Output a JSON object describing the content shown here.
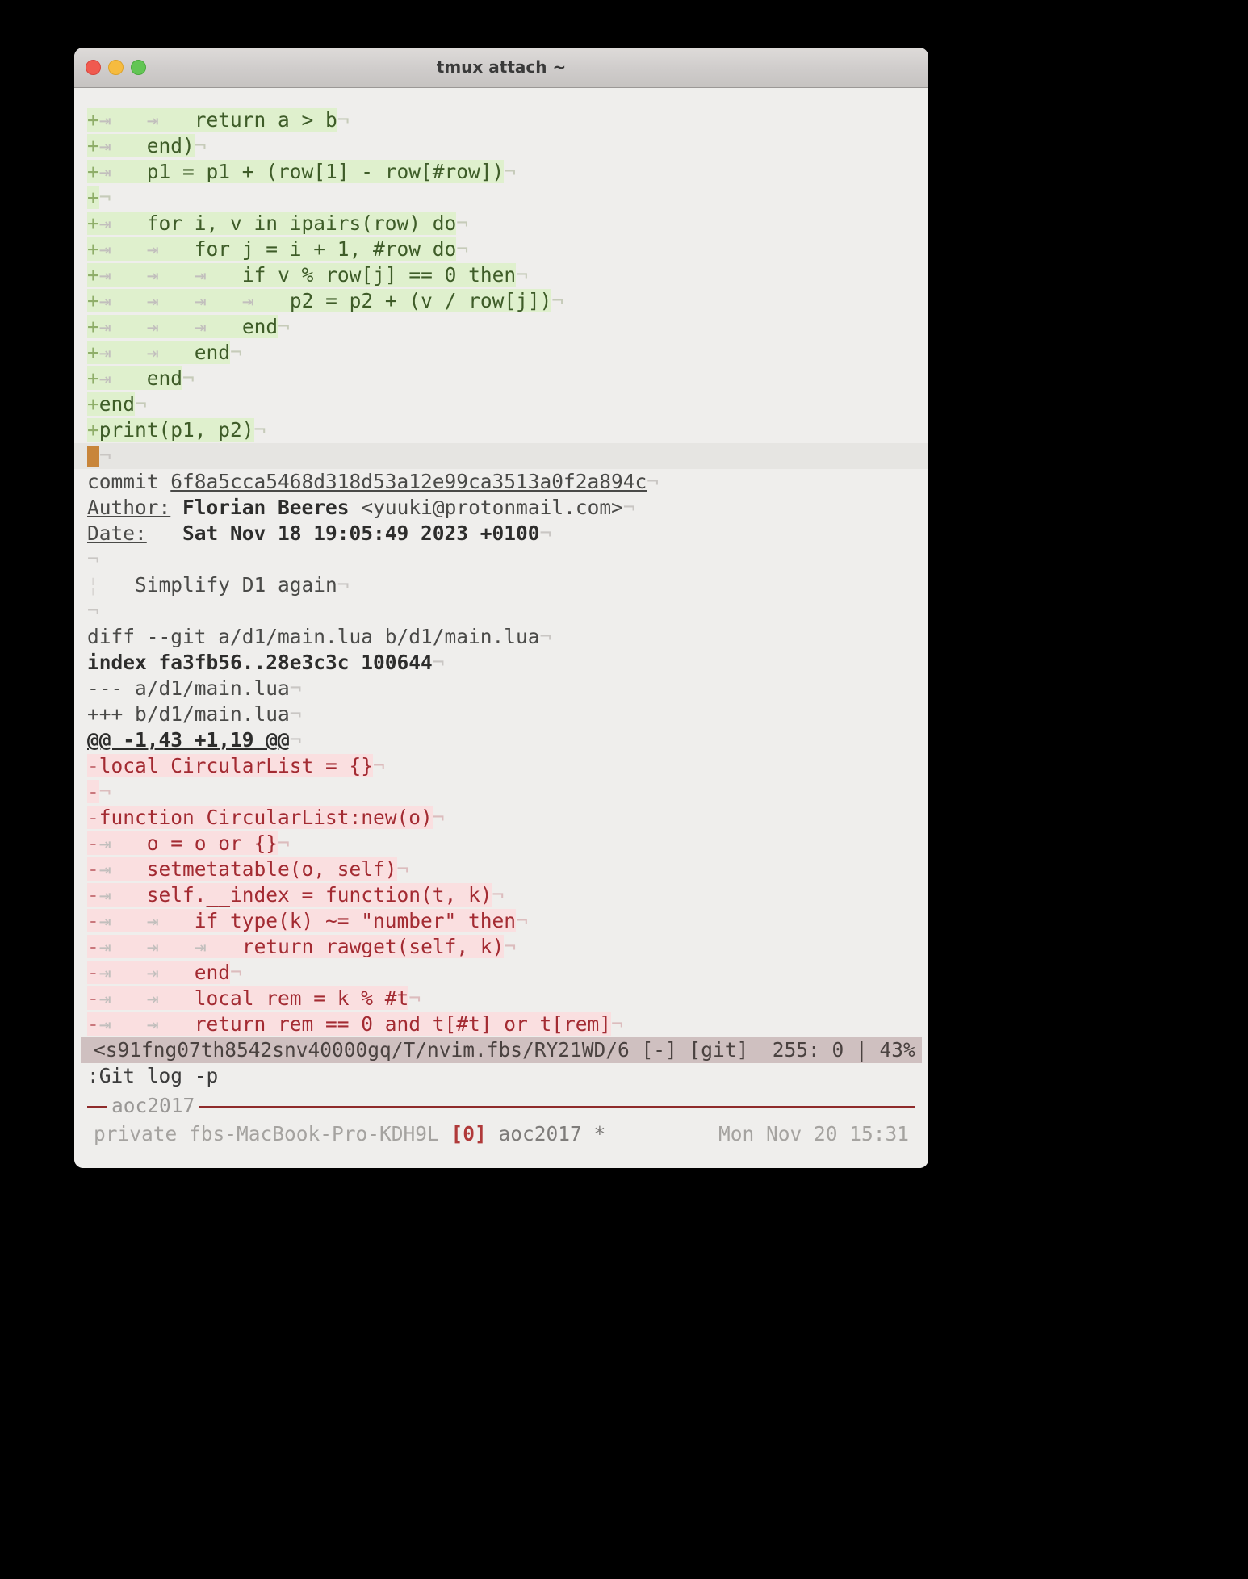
{
  "window": {
    "title": "tmux attach ~",
    "traffic_lights": [
      "close-button",
      "minimize-button",
      "zoom-button"
    ]
  },
  "glyphs": {
    "tab": "⇥",
    "eol": "¬",
    "indent_guide": "¦"
  },
  "terminal": {
    "diff_added": [
      {
        "sign": "+",
        "tabs": 2,
        "text": "return a > b"
      },
      {
        "sign": "+",
        "tabs": 1,
        "text": "end)"
      },
      {
        "sign": "+",
        "tabs": 1,
        "text": "p1 = p1 + (row[1] - row[#row])"
      },
      {
        "sign": "+",
        "tabs": 0,
        "text": ""
      },
      {
        "sign": "+",
        "tabs": 1,
        "text": "for i, v in ipairs(row) do"
      },
      {
        "sign": "+",
        "tabs": 2,
        "text": "for j = i + 1, #row do"
      },
      {
        "sign": "+",
        "tabs": 3,
        "text": "if v % row[j] == 0 then"
      },
      {
        "sign": "+",
        "tabs": 4,
        "text": "p2 = p2 + (v / row[j])"
      },
      {
        "sign": "+",
        "tabs": 3,
        "text": "end"
      },
      {
        "sign": "+",
        "tabs": 2,
        "text": "end"
      },
      {
        "sign": "+",
        "tabs": 1,
        "text": "end"
      },
      {
        "sign": "+",
        "tabs": 0,
        "text": "end"
      },
      {
        "sign": "+",
        "tabs": 0,
        "text": "print(p1, p2)"
      }
    ],
    "commit": {
      "label_commit": "commit ",
      "hash": "6f8a5cca5468d318d53a12e99ca3513a0f2a894c",
      "label_author": "Author:",
      "author_name": "Florian Beeres",
      "author_email": "<yuuki@protonmail.com>",
      "label_date": "Date:",
      "date_value": "Sat Nov 18 19:05:49 2023 +0100",
      "message": "Simplify D1 again"
    },
    "diff_header": {
      "diff_line": "diff --git a/d1/main.lua b/d1/main.lua",
      "index_line": "index fa3fb56..28e3c3c 100644",
      "minus_file": "--- a/d1/main.lua",
      "plus_file": "+++ b/d1/main.lua",
      "hunk": "@@ -1,43 +1,19 @@"
    },
    "diff_removed": [
      {
        "sign": "-",
        "tabs": 0,
        "text": "local CircularList = {}"
      },
      {
        "sign": "-",
        "tabs": 0,
        "text": ""
      },
      {
        "sign": "-",
        "tabs": 0,
        "text": "function CircularList:new(o)"
      },
      {
        "sign": "-",
        "tabs": 1,
        "text": "o = o or {}"
      },
      {
        "sign": "-",
        "tabs": 1,
        "text": "setmetatable(o, self)"
      },
      {
        "sign": "-",
        "tabs": 1,
        "text": "self.__index = function(t, k)"
      },
      {
        "sign": "-",
        "tabs": 2,
        "text": "if type(k) ~= \"number\" then"
      },
      {
        "sign": "-",
        "tabs": 3,
        "text": "return rawget(self, k)"
      },
      {
        "sign": "-",
        "tabs": 2,
        "text": "end"
      },
      {
        "sign": "-",
        "tabs": 2,
        "text": "local rem = k % #t"
      },
      {
        "sign": "-",
        "tabs": 2,
        "text": "return rem == 0 and t[#t] or t[rem]"
      }
    ],
    "nvim_statusline": "<s91fng07th8542snv40000gq/T/nvim.fbs/RY21WD/6 [-] [git]  255: 0 | 43%",
    "command_line": ":Git log -p"
  },
  "tmux": {
    "separator_label": "aoc2017",
    "left_prefix": "private fbs-MacBook-Pro-KDH9L ",
    "window_index": "[0]",
    "session_name": " aoc2017 *",
    "clock": "Mon Nov 20 15:31"
  },
  "colors": {
    "added_bg": "#dff0cd",
    "added_fg": "#3e5c28",
    "removed_bg": "#fadfe0",
    "removed_fg": "#a32b32",
    "cursor": "#c8853a",
    "statusline_bg": "#cfc0c0",
    "tmux_accent": "#8f2b2b",
    "terminal_bg": "#efeeec"
  }
}
